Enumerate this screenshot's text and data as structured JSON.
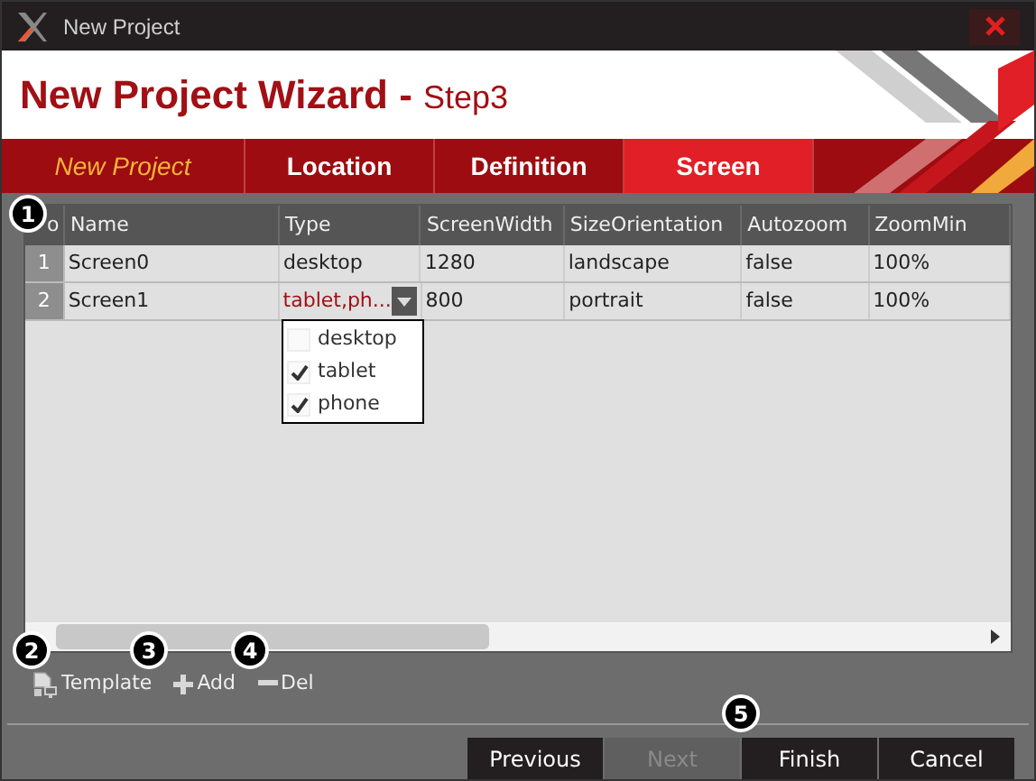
{
  "window": {
    "title": "New Project"
  },
  "header": {
    "title": "New Project Wizard - ",
    "step": "Step3"
  },
  "steps": [
    {
      "label": "New Project",
      "kind": "brand",
      "selected": false
    },
    {
      "label": "Location",
      "kind": "step",
      "selected": false
    },
    {
      "label": "Definition",
      "kind": "step",
      "selected": false
    },
    {
      "label": "Screen",
      "kind": "step",
      "selected": true
    }
  ],
  "table": {
    "columns": [
      "o",
      "Name",
      "Type",
      "ScreenWidth",
      "SizeOrientation",
      "Autozoom",
      "ZoomMin"
    ],
    "rows": [
      {
        "cells": [
          {
            "text": "1",
            "editing": false
          },
          {
            "text": "Screen0",
            "editing": false
          },
          {
            "text": "desktop",
            "editing": false
          },
          {
            "text": "1280",
            "editing": false
          },
          {
            "text": "landscape",
            "editing": false
          },
          {
            "text": "false",
            "editing": false
          },
          {
            "text": "100%",
            "editing": false
          }
        ]
      },
      {
        "cells": [
          {
            "text": "2",
            "editing": false
          },
          {
            "text": "Screen1",
            "editing": false
          },
          {
            "text": "tablet,ph...",
            "editing": true
          },
          {
            "text": "800",
            "editing": false
          },
          {
            "text": "portrait",
            "editing": false
          },
          {
            "text": "false",
            "editing": false
          },
          {
            "text": "100%",
            "editing": false
          }
        ]
      }
    ],
    "dropdown": [
      {
        "label": "desktop",
        "checked": false
      },
      {
        "label": "tablet",
        "checked": true
      },
      {
        "label": "phone",
        "checked": true
      }
    ]
  },
  "toolbar": [
    {
      "label": "Template",
      "kind": "template"
    },
    {
      "label": "Add",
      "kind": "add"
    },
    {
      "label": "Del",
      "kind": "del"
    }
  ],
  "buttons": [
    {
      "label": "Previous",
      "disabled": false
    },
    {
      "label": "Next",
      "disabled": true
    },
    {
      "label": "Finish",
      "disabled": false
    },
    {
      "label": "Cancel",
      "disabled": false
    }
  ],
  "callouts": [
    "1",
    "2",
    "3",
    "4",
    "5"
  ]
}
